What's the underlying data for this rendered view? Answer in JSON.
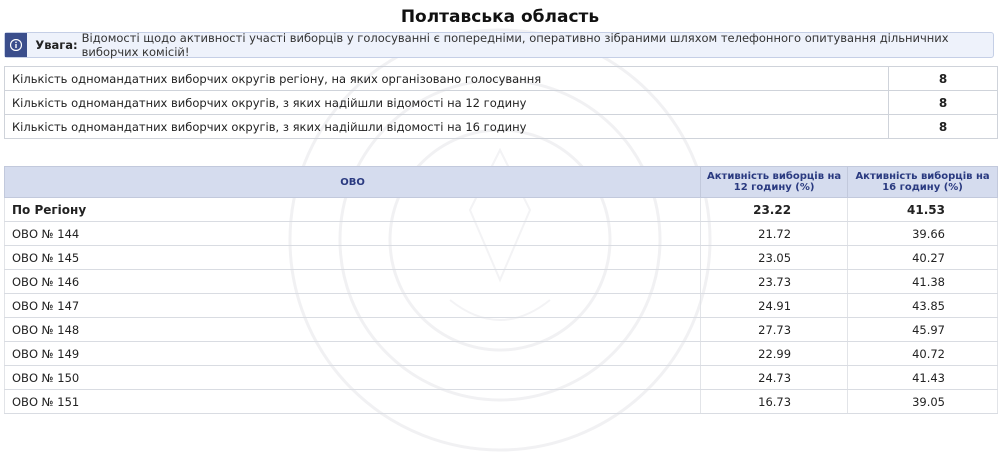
{
  "title": "Полтавська область",
  "alert": {
    "icon": "info-icon",
    "label": "Увага:",
    "text": "Відомості щодо активності участі виборців у голосуванні є попередніми, оперативно зібраними шляхом телефонного опитування дільничних виборчих комісій!"
  },
  "summary": [
    {
      "label": "Кількість одномандатних виборчих округів регіону, на яких організовано голосування",
      "value": "8"
    },
    {
      "label": "Кількість одномандатних виборчих округів, з яких надійшли відомості на 12 годину",
      "value": "8"
    },
    {
      "label": "Кількість одномандатних виборчих округів, з яких надійшли відомості на 16 годину",
      "value": "8"
    }
  ],
  "table": {
    "headers": [
      "ОВО",
      "Активність виборців на 12 годину (%)",
      "Активність виборців на 16 годину (%)"
    ],
    "region_row": {
      "name": "По Регіону",
      "v12": "23.22",
      "v16": "41.53"
    },
    "rows": [
      {
        "name": "ОВО № 144",
        "v12": "21.72",
        "v16": "39.66"
      },
      {
        "name": "ОВО № 145",
        "v12": "23.05",
        "v16": "40.27"
      },
      {
        "name": "ОВО № 146",
        "v12": "23.73",
        "v16": "41.38"
      },
      {
        "name": "ОВО № 147",
        "v12": "24.91",
        "v16": "43.85"
      },
      {
        "name": "ОВО № 148",
        "v12": "27.73",
        "v16": "45.97"
      },
      {
        "name": "ОВО № 149",
        "v12": "22.99",
        "v16": "40.72"
      },
      {
        "name": "ОВО № 150",
        "v12": "24.73",
        "v16": "41.43"
      },
      {
        "name": "ОВО № 151",
        "v12": "16.73",
        "v16": "39.05"
      }
    ]
  },
  "colors": {
    "header_bg": "#d5dcee",
    "header_text": "#2a3a80",
    "alert_icon_bg": "#3b4e8c",
    "alert_bg": "#eef2fb"
  }
}
